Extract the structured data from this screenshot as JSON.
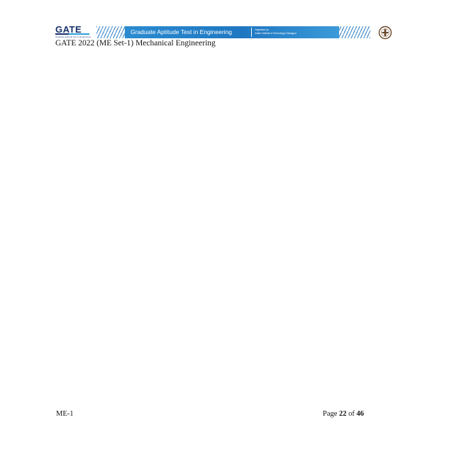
{
  "header": {
    "logo_text": "GATE",
    "logo_subtitle": "Graduate Aptitude Test in Engineering",
    "banner_title": "Graduate Aptitude Test in Engineering",
    "organizer_line1": "Organised by",
    "organizer_line2": "Indian Institute of Technology Kharagpur",
    "emblem_icon": "iit-kharagpur-emblem-icon",
    "colors": {
      "navy": "#17306b",
      "blue": "#1f77c2",
      "light_blue": "#2aa0d8"
    }
  },
  "document": {
    "title": "GATE 2022 (ME Set-1) Mechanical Engineering"
  },
  "footer": {
    "paper_code": "ME-1",
    "page_prefix": "Page",
    "page_number": "22",
    "page_of": "of",
    "page_total": "46"
  }
}
